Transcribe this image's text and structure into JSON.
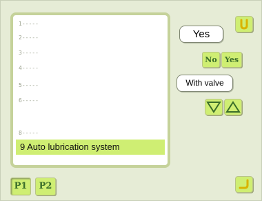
{
  "list": {
    "rows": [
      "1-----",
      "2-----",
      "3-----",
      "4-----",
      "5-----",
      "6-----",
      "8-----"
    ],
    "selected": "9 Auto lubrication system"
  },
  "value_panel": {
    "current_value": "Yes",
    "no_label": "No",
    "yes_label": "Yes",
    "valve_mode": "With valve"
  },
  "tabs": [
    "P1",
    "P2"
  ],
  "icons": {
    "top_right": "return-u-icon",
    "bottom_right": "enter-icon",
    "down": "down-triangle-icon",
    "up": "up-triangle-icon"
  },
  "colors": {
    "background": "#e6ecd6",
    "accent": "#cfee73",
    "icon_green": "#3a6d2a"
  }
}
